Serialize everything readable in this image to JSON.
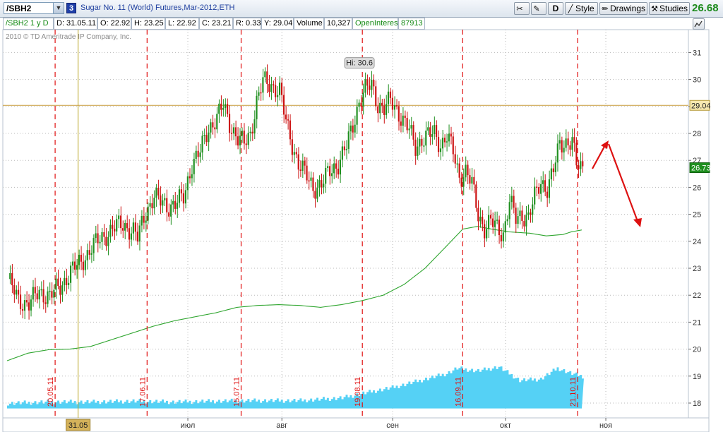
{
  "toolbar": {
    "symbol": "/SBH2",
    "link_group": "3",
    "description": "Sugar No. 11 (World)  Futures,Mar-2012,ETH",
    "style_label": "Style",
    "drawings_label": "Drawings",
    "studies_label": "Studies",
    "period_label": "D",
    "last_price": "26.68",
    "last_price_color": "#1c8a1c"
  },
  "infobar": {
    "symbol_period": "/SBH2 1 y D",
    "date": "D: 31.05.11",
    "open": "O: 22.92",
    "high": "H: 23.25",
    "low": "L: 22.92",
    "close": "C: 23.21",
    "range": "R: 0.33",
    "y_value": "Y: 29.04",
    "volume_label": "Volume",
    "volume_value": "10,327",
    "oi_label": "OpenInterest",
    "oi_value": "87913"
  },
  "copyright": "2010 © TD Ameritrade IP Company, Inc.",
  "chart_data": {
    "type": "candlestick",
    "ylim": [
      17.8,
      31.8
    ],
    "y_ticks": [
      18,
      19,
      20,
      21,
      22,
      23,
      24,
      25,
      26,
      27,
      28,
      29,
      30,
      31
    ],
    "x_month_labels": [
      {
        "bar": 86.5,
        "label": "июл"
      },
      {
        "bar": 131.5,
        "label": "авг"
      },
      {
        "bar": 184.5,
        "label": "сен"
      },
      {
        "bar": 238.5,
        "label": "окт"
      },
      {
        "bar": 286.5,
        "label": "ноя"
      }
    ],
    "cursor": {
      "bar": 34,
      "date_label": "31.05",
      "price": 29.04,
      "price_label": "29.04"
    },
    "last_price_label": "26.73",
    "high_annotation": {
      "bar": 174,
      "price": 30.6,
      "label": "Hi: 30.6"
    },
    "vertical_markers": [
      {
        "bar": 23,
        "label": "20.05.11"
      },
      {
        "bar": 67,
        "label": "17.06.11"
      },
      {
        "bar": 112,
        "label": "15.07.11"
      },
      {
        "bar": 170,
        "label": "19.08.11"
      },
      {
        "bar": 218,
        "label": "16.09.11"
      },
      {
        "bar": 273,
        "label": "21.10.11"
      }
    ],
    "up_color": "#1f8f1f",
    "down_color": "#cc1111",
    "volume_color": "#55d1f5",
    "oi_line_color": "#2ea52e",
    "marker_color": "#e01010",
    "arrow_color": "#dd1111",
    "price_points": [
      [
        0,
        22.6
      ],
      [
        5,
        21.8
      ],
      [
        10,
        21.7
      ],
      [
        15,
        22.1
      ],
      [
        20,
        22.0
      ],
      [
        25,
        22.3
      ],
      [
        30,
        22.9
      ],
      [
        35,
        23.2
      ],
      [
        40,
        23.8
      ],
      [
        45,
        24.1
      ],
      [
        50,
        24.5
      ],
      [
        55,
        24.6
      ],
      [
        60,
        24.4
      ],
      [
        62,
        24.1
      ],
      [
        66,
        25.1
      ],
      [
        70,
        25.7
      ],
      [
        72,
        25.5
      ],
      [
        76,
        25.3
      ],
      [
        80,
        25.4
      ],
      [
        84,
        25.6
      ],
      [
        88,
        26.9
      ],
      [
        92,
        27.3
      ],
      [
        96,
        28.2
      ],
      [
        100,
        28.6
      ],
      [
        103,
        29.0
      ],
      [
        106,
        28.4
      ],
      [
        110,
        27.8
      ],
      [
        113,
        27.6
      ],
      [
        116,
        28.0
      ],
      [
        119,
        29.2
      ],
      [
        122,
        29.9
      ],
      [
        126,
        29.8
      ],
      [
        130,
        29.6
      ],
      [
        133,
        28.4
      ],
      [
        136,
        27.6
      ],
      [
        139,
        26.9
      ],
      [
        142,
        26.5
      ],
      [
        146,
        26.0
      ],
      [
        150,
        26.1
      ],
      [
        154,
        26.6
      ],
      [
        158,
        26.9
      ],
      [
        162,
        27.5
      ],
      [
        165,
        28.3
      ],
      [
        168,
        29.2
      ],
      [
        171,
        29.6
      ],
      [
        174,
        29.8
      ],
      [
        177,
        29.1
      ],
      [
        180,
        28.9
      ],
      [
        183,
        29.2
      ],
      [
        186,
        28.9
      ],
      [
        189,
        28.5
      ],
      [
        192,
        28.1
      ],
      [
        195,
        27.5
      ],
      [
        198,
        27.8
      ],
      [
        201,
        27.9
      ],
      [
        204,
        28.0
      ],
      [
        207,
        27.6
      ],
      [
        210,
        27.9
      ],
      [
        213,
        27.3
      ],
      [
        216,
        26.4
      ],
      [
        219,
        26.6
      ],
      [
        222,
        26.1
      ],
      [
        225,
        25.0
      ],
      [
        228,
        24.5
      ],
      [
        231,
        24.7
      ],
      [
        234,
        24.5
      ],
      [
        237,
        24.3
      ],
      [
        240,
        25.5
      ],
      [
        243,
        24.8
      ],
      [
        246,
        25.0
      ],
      [
        249,
        24.9
      ],
      [
        252,
        25.6
      ],
      [
        255,
        26.2
      ],
      [
        258,
        26.0
      ],
      [
        261,
        26.6
      ],
      [
        264,
        27.6
      ],
      [
        267,
        27.7
      ],
      [
        270,
        27.7
      ],
      [
        272,
        26.8
      ],
      [
        275,
        26.7
      ]
    ],
    "open_interest_points": [
      [
        0,
        19.57
      ],
      [
        10,
        19.85
      ],
      [
        20,
        19.98
      ],
      [
        30,
        20.0
      ],
      [
        40,
        20.1
      ],
      [
        50,
        20.35
      ],
      [
        60,
        20.6
      ],
      [
        70,
        20.85
      ],
      [
        80,
        21.05
      ],
      [
        90,
        21.2
      ],
      [
        100,
        21.35
      ],
      [
        110,
        21.55
      ],
      [
        120,
        21.62
      ],
      [
        130,
        21.65
      ],
      [
        140,
        21.62
      ],
      [
        150,
        21.55
      ],
      [
        160,
        21.65
      ],
      [
        170,
        21.8
      ],
      [
        180,
        22.0
      ],
      [
        190,
        22.4
      ],
      [
        200,
        23.0
      ],
      [
        210,
        23.8
      ],
      [
        218,
        24.45
      ],
      [
        225,
        24.55
      ],
      [
        232,
        24.45
      ],
      [
        240,
        24.35
      ],
      [
        250,
        24.3
      ],
      [
        258,
        24.2
      ],
      [
        266,
        24.25
      ],
      [
        270,
        24.35
      ],
      [
        275,
        24.42
      ]
    ],
    "volume_points": [
      [
        0,
        18.0
      ],
      [
        20,
        18.05
      ],
      [
        40,
        18.05
      ],
      [
        60,
        18.08
      ],
      [
        80,
        18.05
      ],
      [
        100,
        18.08
      ],
      [
        120,
        18.1
      ],
      [
        140,
        18.1
      ],
      [
        160,
        18.2
      ],
      [
        175,
        18.45
      ],
      [
        185,
        18.6
      ],
      [
        200,
        18.9
      ],
      [
        210,
        19.1
      ],
      [
        215,
        19.3
      ],
      [
        225,
        19.2
      ],
      [
        235,
        19.35
      ],
      [
        245,
        18.85
      ],
      [
        255,
        18.9
      ],
      [
        263,
        19.3
      ],
      [
        270,
        19.1
      ],
      [
        275,
        19.0
      ]
    ]
  }
}
